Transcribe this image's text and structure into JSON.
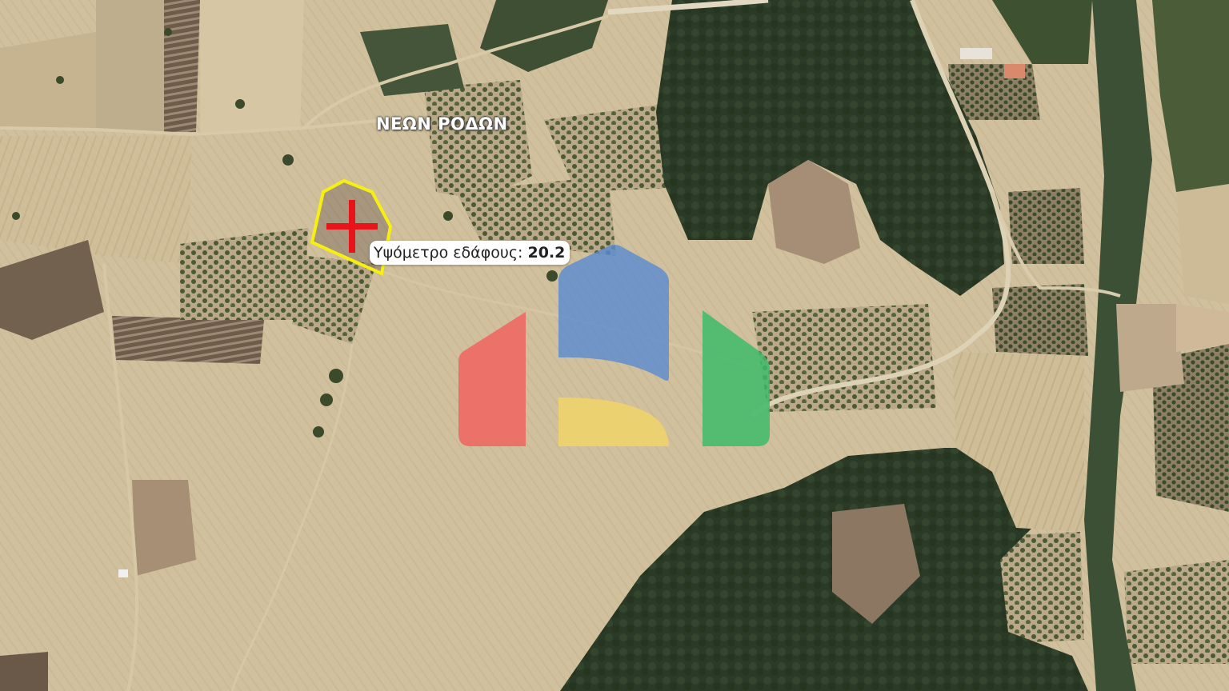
{
  "map": {
    "place_label": "ΝΕΩΝ ΡΟΔΩΝ",
    "tooltip": {
      "label": "Υψόμετρο εδάφους:",
      "value": "20.2"
    },
    "marker_icon": "red-cross-icon",
    "parcel_outline_color": "#f7ef12",
    "marker_color": "#e8141a"
  },
  "watermark": {
    "icon": "house-logo-watermark",
    "colors": [
      "#f0605e",
      "#5b8bd0",
      "#f1d36a",
      "#3dbb6a"
    ]
  }
}
